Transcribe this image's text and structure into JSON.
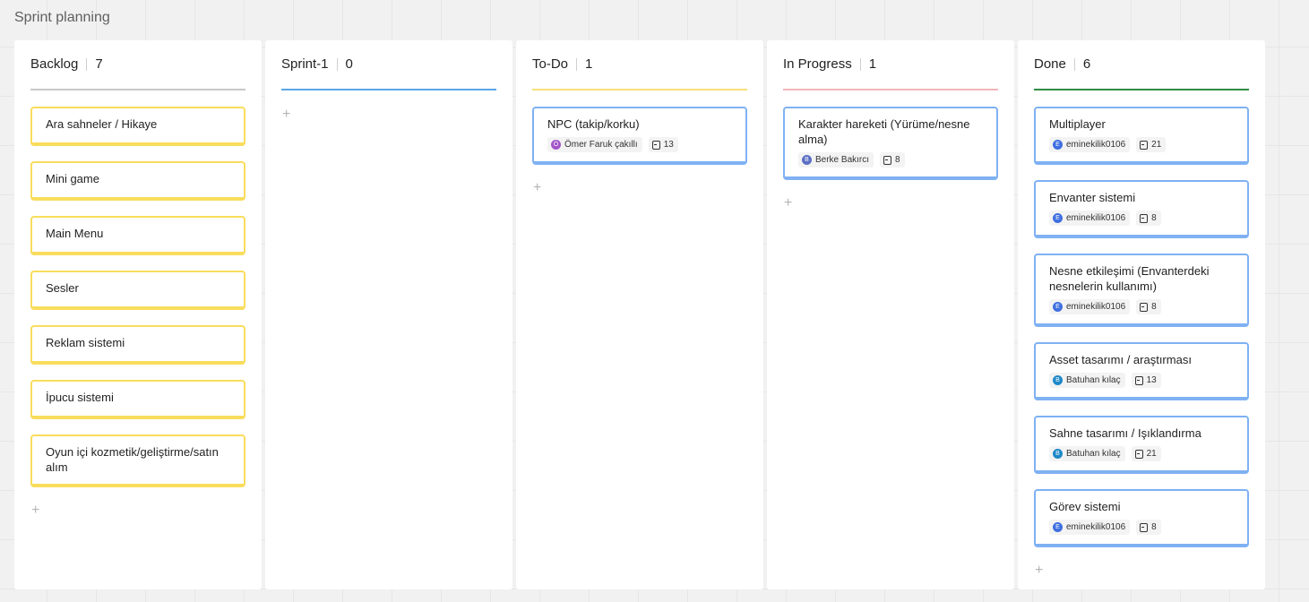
{
  "board": {
    "title": "Sprint planning"
  },
  "add_glyph": "+",
  "columns": [
    {
      "name": "Backlog",
      "count": "7",
      "color": "#c8c8c8",
      "cards": [
        {
          "title": "Ara sahneler / Hikaye"
        },
        {
          "title": "Mini game"
        },
        {
          "title": "Main Menu"
        },
        {
          "title": "Sesler"
        },
        {
          "title": "Reklam sistemi"
        },
        {
          "title": "İpucu sistemi"
        },
        {
          "title": "Oyun içi kozmetik/geliştirme/satın alım"
        }
      ]
    },
    {
      "name": "Sprint-1",
      "count": "0",
      "color": "#5aa7e6",
      "cards": []
    },
    {
      "name": "To-Do",
      "count": "1",
      "color": "#f8e07a",
      "cards": [
        {
          "title": "NPC (takip/korku)",
          "assignee": "Ömer Faruk çakıllı",
          "avatar": "Ö",
          "avatar_color": "#a155c9",
          "points": "13"
        }
      ]
    },
    {
      "name": "In Progress",
      "count": "1",
      "color": "#f2b4b8",
      "cards": [
        {
          "title": "Karakter hareketi (Yürüme/nesne alma)",
          "assignee": "Berke Bakırcı",
          "avatar": "B",
          "avatar_color": "#5a6fc4",
          "points": "8"
        }
      ]
    },
    {
      "name": "Done",
      "count": "6",
      "color": "#2e8b45",
      "cards": [
        {
          "title": "Multiplayer",
          "assignee": "eminekilik0106",
          "avatar": "E",
          "avatar_color": "#3f6fe0",
          "points": "21"
        },
        {
          "title": "Envanter sistemi",
          "assignee": "eminekilik0106",
          "avatar": "E",
          "avatar_color": "#3f6fe0",
          "points": "8"
        },
        {
          "title": "Nesne etkileşimi (Envanterdeki nesnelerin kullanımı)",
          "assignee": "eminekilik0106",
          "avatar": "E",
          "avatar_color": "#3f6fe0",
          "points": "8"
        },
        {
          "title": "Asset tasarımı / araştırması",
          "assignee": "Batuhan kılaç",
          "avatar": "B",
          "avatar_color": "#1e88c8",
          "points": "13"
        },
        {
          "title": "Sahne tasarımı / Işıklandırma",
          "assignee": "Batuhan kılaç",
          "avatar": "B",
          "avatar_color": "#1e88c8",
          "points": "21"
        },
        {
          "title": "Görev sistemi",
          "assignee": "eminekilik0106",
          "avatar": "E",
          "avatar_color": "#3f6fe0",
          "points": "8"
        }
      ]
    }
  ]
}
